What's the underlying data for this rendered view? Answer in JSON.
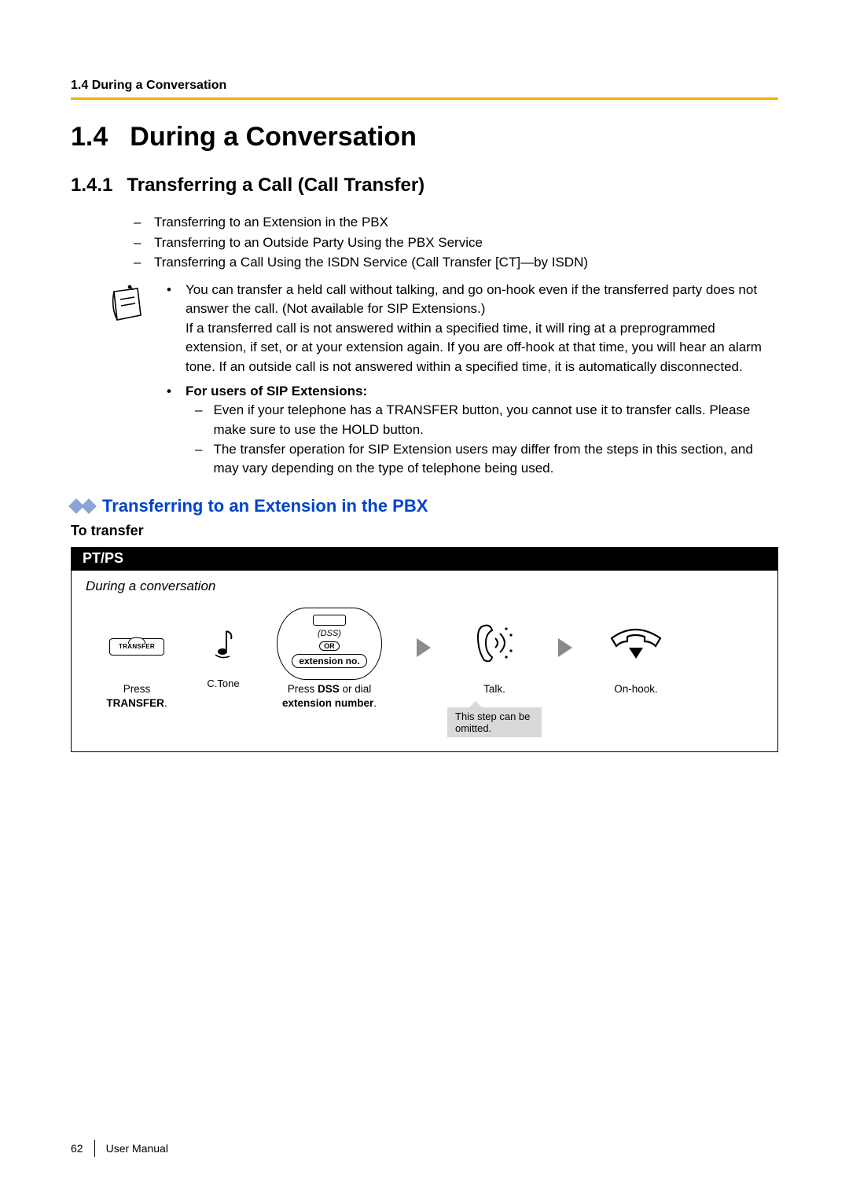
{
  "running_head": "1.4 During a Conversation",
  "h1_num": "1.4",
  "h1_title": "During a Conversation",
  "h2_num": "1.4.1",
  "h2_title": "Transferring a Call (Call Transfer)",
  "top_list": [
    "Transferring to an Extension in the PBX",
    "Transferring to an Outside Party Using the PBX Service",
    "Transferring a Call Using the ISDN Service (Call Transfer [CT]—by ISDN)"
  ],
  "note_para1": "You can transfer a held call without talking, and go on-hook even if the transferred party does not answer the call. (Not available for SIP Extensions.)",
  "note_para2": "If a transferred call is not answered within a specified time, it will ring at a preprogrammed extension, if set, or at your extension again. If you are off-hook at that time, you will hear an alarm tone. If an outside call is not answered within a specified time, it is automatically disconnected.",
  "sip_heading": "For users of SIP Extensions:",
  "sip_sub1": "Even if your telephone has a TRANSFER button, you cannot use it to transfer calls. Please make sure to use the HOLD button.",
  "sip_sub2": "The transfer operation for SIP Extension users may differ from the steps in this section, and may vary depending on the type of telephone being used.",
  "blue_heading": "Transferring to an Extension in the PBX",
  "to_transfer": "To transfer",
  "pt_tag": "PT/PS",
  "during_label": "During a conversation",
  "transfer_key_label": "TRANSFER",
  "ctone": "C.Tone",
  "dss_label": "(DSS)",
  "or_label": "OR",
  "ext_pill": "extension no.",
  "step1_cap_a": "Press",
  "step1_cap_b": "TRANSFER",
  "step1_cap_c": ".",
  "step2_cap_a": "Press ",
  "step2_cap_b": "DSS",
  "step2_cap_c": " or dial",
  "step2_cap_d": "extension number",
  "step2_cap_e": ".",
  "step3_cap": "Talk.",
  "step4_cap": "On-hook.",
  "omit_note": "This step can be omitted.",
  "footer_page": "62",
  "footer_doc": "User Manual"
}
